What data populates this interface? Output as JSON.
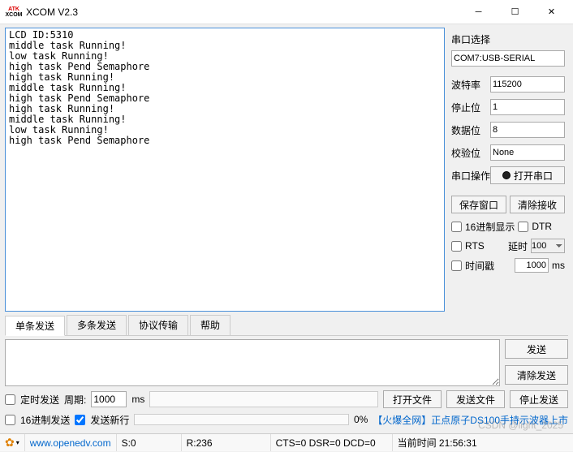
{
  "window": {
    "title": "XCOM V2.3",
    "icon_top": "ATK",
    "icon_bot": "XCOM"
  },
  "rx_text": "LCD ID:5310\nmiddle task Running!\nlow task Running!\nhigh task Pend Semaphore\nhigh task Running!\nmiddle task Running!\nhigh task Pend Semaphore\nhigh task Running!\nmiddle task Running!\nlow task Running!\nhigh task Pend Semaphore",
  "panel": {
    "port_title": "串口选择",
    "port_value": "COM7:USB-SERIAL",
    "baud_label": "波特率",
    "baud_value": "115200",
    "stop_label": "停止位",
    "stop_value": "1",
    "data_label": "数据位",
    "data_value": "8",
    "parity_label": "校验位",
    "parity_value": "None",
    "op_label": "串口操作",
    "open_btn": "打开串口",
    "save_win": "保存窗口",
    "clear_rx": "清除接收",
    "hex_disp": "16进制显示",
    "dtr": "DTR",
    "rts": "RTS",
    "delay_label": "延时",
    "delay_value": "100",
    "timestamp": "时间戳",
    "ts_value": "1000",
    "ts_unit": "ms"
  },
  "tabs": {
    "t1": "单条发送",
    "t2": "多条发送",
    "t3": "协议传输",
    "t4": "帮助"
  },
  "tx_btns": {
    "send": "发送",
    "clear": "清除发送"
  },
  "row1": {
    "timed_send": "定时发送",
    "cycle_label": "周期:",
    "cycle_value": "1000",
    "cycle_unit": "ms",
    "open_file": "打开文件",
    "send_file": "发送文件",
    "stop_send": "停止发送"
  },
  "row2": {
    "hex_send": "16进制发送",
    "send_newline": "发送新行",
    "pct": "0%",
    "promo": "【火爆全网】正点原子DS100手持示波器上市"
  },
  "status": {
    "url": "www.openedv.com",
    "s": "S:0",
    "r": "R:236",
    "cts": "CTS=0 DSR=0 DCD=0",
    "time": "当前时间 21:56:31"
  },
  "watermark": "CSDN @light_2025"
}
